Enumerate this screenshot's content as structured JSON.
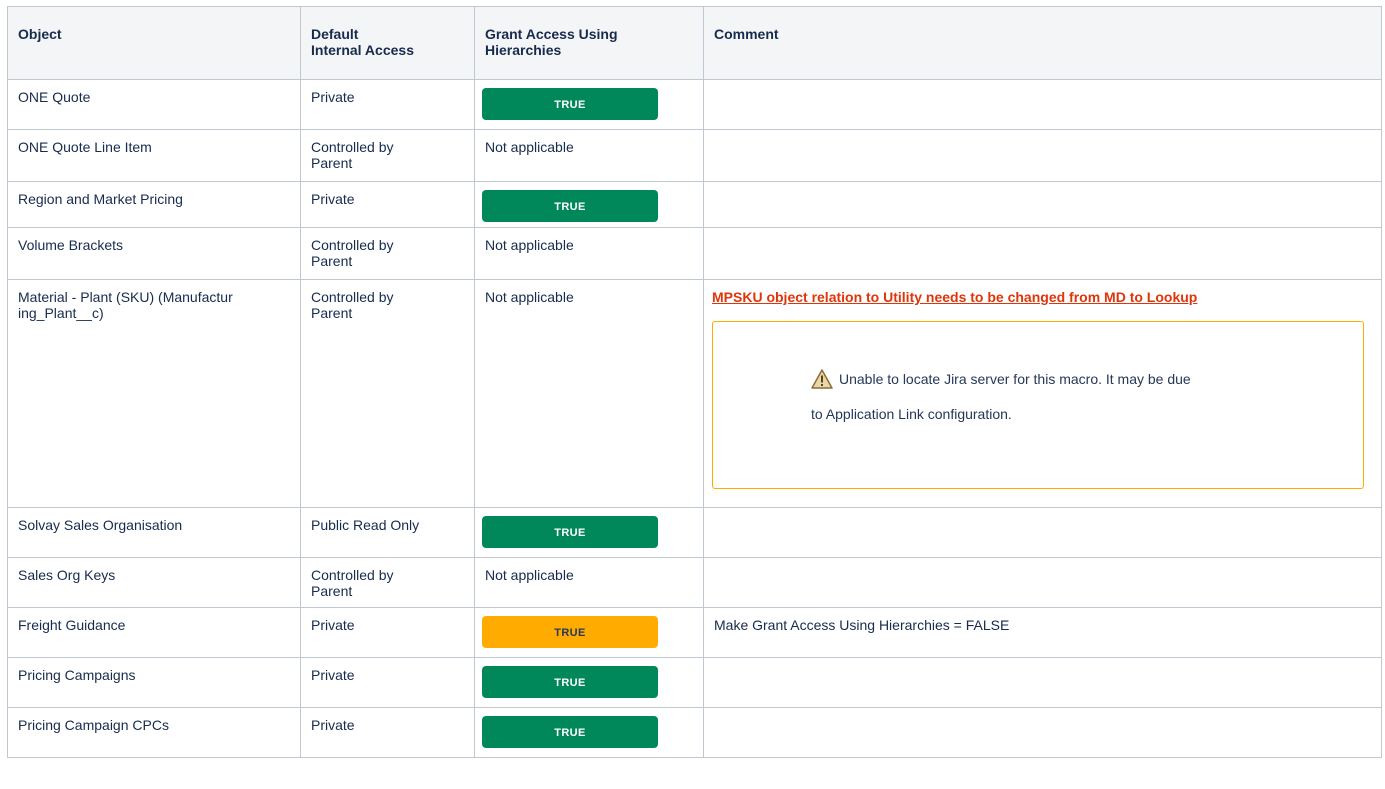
{
  "table": {
    "headers": {
      "object": "Object",
      "access_line1": "Default",
      "access_line2": "Internal Access",
      "grant_line1": "Grant Access Using",
      "grant_line2": "Hierarchies",
      "comment": "Comment"
    },
    "rows": [
      {
        "object": "ONE Quote",
        "access": "Private",
        "grant": "TRUE",
        "comment": ""
      },
      {
        "object": "ONE Quote Line Item",
        "access_line1": "Controlled by",
        "access_line2": "Parent",
        "grant": "Not applicable",
        "comment": ""
      },
      {
        "object": "Region and Market Pricing",
        "access": "Private",
        "grant": "TRUE",
        "comment": ""
      },
      {
        "object": "Volume Brackets",
        "access_line1": "Controlled by",
        "access_line2": "Parent",
        "grant": "Not applicable",
        "comment": ""
      },
      {
        "object_line1": "Material - Plant (SKU) (Manufactur",
        "object_line2": "ing_Plant__c)",
        "access_line1": "Controlled by",
        "access_line2": "Parent",
        "grant": "Not applicable",
        "comment_link": "MPSKU object relation to Utility needs to be changed from MD to Lookup",
        "warning_line1": "Unable to locate Jira server for this macro. It may be due",
        "warning_line2": "to Application Link configuration."
      },
      {
        "object": "Solvay Sales Organisation",
        "access": "Public Read Only",
        "grant": "TRUE",
        "comment": ""
      },
      {
        "object": "Sales Org Keys",
        "access_line1": "Controlled by",
        "access_line2": "Parent",
        "grant": "Not applicable",
        "comment": ""
      },
      {
        "object": "Freight Guidance",
        "access": "Private",
        "grant": "TRUE",
        "comment": "Make Grant Access Using Hierarchies = FALSE"
      },
      {
        "object": "Pricing Campaigns",
        "access": "Private",
        "grant": "TRUE",
        "comment": ""
      },
      {
        "object": "Pricing Campaign CPCs",
        "access": "Private",
        "grant": "TRUE",
        "comment": ""
      }
    ]
  },
  "colors": {
    "lozenge_green": "#00875a",
    "lozenge_yellow": "#ffab00",
    "error_red": "#de350b",
    "border": "#c1c7d0",
    "header_bg": "#f4f5f7"
  },
  "icons": {
    "warning": "warning-icon"
  }
}
